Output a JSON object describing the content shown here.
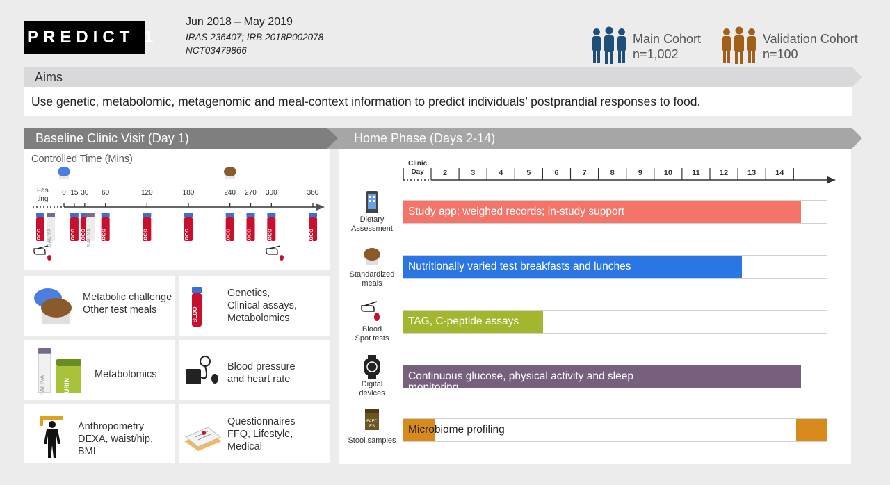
{
  "header": {
    "logo": "PREDICT 1",
    "dates": "Jun 2018 – May 2019",
    "ids_line1": "IRAS 236407;  IRB 2018P002078",
    "ids_line2": "NCT03479866",
    "main_cohort": {
      "title": "Main Cohort",
      "n": "n=1,002",
      "color": "#1f4e79"
    },
    "validation_cohort": {
      "title": "Validation Cohort",
      "n": "n=100",
      "color": "#a0601a"
    }
  },
  "aims": {
    "label": "Aims",
    "text": "Use genetic, metabolomic, metagenomic and meal-context information to predict individuals’ postprandial responses to food."
  },
  "baseline": {
    "title": "Baseline Clinic Visit (Day 1)",
    "subtitle": "Controlled Time (Mins)",
    "fasting_label": [
      "Fas",
      "ting"
    ],
    "timepoints": [
      "0",
      "15",
      "30",
      "60",
      "120",
      "180",
      "240",
      "270",
      "300",
      "360"
    ],
    "blood_label": "BLOOD",
    "saliva_label": "SALIVA",
    "urine_label": "URIN\nE",
    "tiles": [
      {
        "text": [
          "Metabolic challenge",
          "Other test meals"
        ]
      },
      {
        "text": [
          "Genetics,",
          "Clinical assays,",
          "Metabolomics"
        ]
      },
      {
        "text": [
          "Metabolomics"
        ]
      },
      {
        "text": [
          "Blood pressure",
          "and heart rate"
        ]
      },
      {
        "text": [
          "Anthropometry",
          "DEXA, waist/hip,",
          "BMI"
        ]
      },
      {
        "text": [
          "Questionnaires",
          "FFQ, Lifestyle,",
          "Medical"
        ]
      }
    ]
  },
  "home": {
    "title": "Home Phase (Days 2-14)",
    "axis_title": [
      "Clinic",
      "Day"
    ],
    "days": [
      "2",
      "3",
      "4",
      "5",
      "6",
      "7",
      "8",
      "9",
      "10",
      "11",
      "12",
      "13",
      "14"
    ],
    "rows": [
      {
        "label": [
          "Dietary",
          "Assessment"
        ],
        "bar": "Study app; weighed records; in-study support",
        "fill": 0.94,
        "color": "#f47469"
      },
      {
        "label": [
          "Standardized",
          "meals"
        ],
        "bar": "Nutritionally varied test breakfasts and lunches",
        "fill": 0.8,
        "color": "#2b76e5"
      },
      {
        "label": [
          "Blood",
          "Spot tests"
        ],
        "bar": "TAG, C-peptide assays",
        "fill": 0.33,
        "color": "#a3b62e"
      },
      {
        "label": [
          "Digital",
          "devices"
        ],
        "bar": "Continuous glucose, physical activity and sleep",
        "bar_cut": "monitoring",
        "fill": 0.94,
        "color": "#76607e"
      },
      {
        "label": [
          "Stool samples"
        ],
        "bar": "Microbiome profiling",
        "color": "#d98a1c",
        "fill_start": 0.074,
        "fill_end_start": 0.927,
        "label_color": "#222"
      }
    ]
  },
  "colors": {
    "panel_head": "#7f7f7f",
    "blood_cap": "#3b6fd6",
    "blood_body": "#c8102e"
  }
}
